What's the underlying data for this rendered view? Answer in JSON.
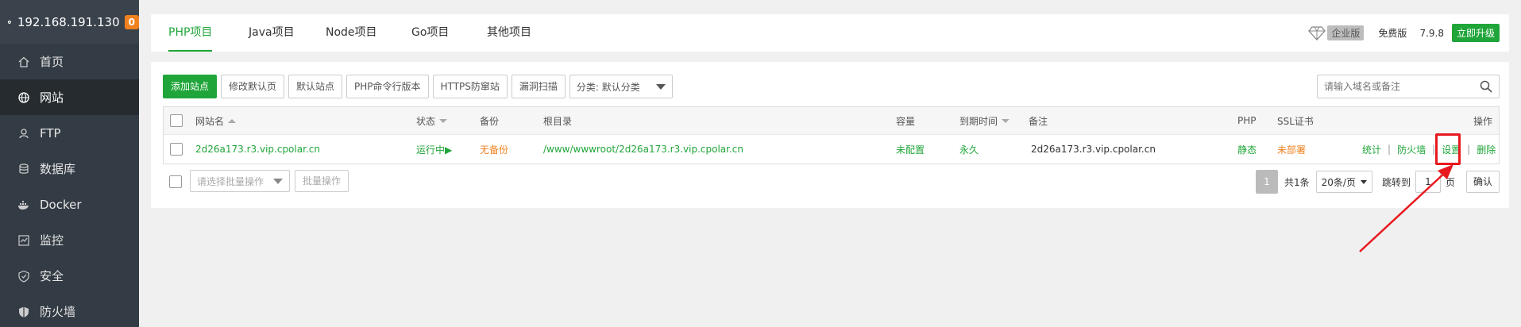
{
  "sidebar": {
    "ip": "192.168.191.130",
    "badge": "0",
    "items": [
      {
        "label": "首页",
        "icon": "home-icon"
      },
      {
        "label": "网站",
        "icon": "globe-icon"
      },
      {
        "label": "FTP",
        "icon": "ftp-icon"
      },
      {
        "label": "数据库",
        "icon": "database-icon"
      },
      {
        "label": "Docker",
        "icon": "docker-icon"
      },
      {
        "label": "监控",
        "icon": "monitor-icon"
      },
      {
        "label": "安全",
        "icon": "shield-check-icon"
      },
      {
        "label": "防火墙",
        "icon": "firewall-icon"
      }
    ]
  },
  "tabs": [
    "PHP项目",
    "Java项目",
    "Node项目",
    "Go项目",
    "其他项目"
  ],
  "topinfo": {
    "enterprise": "企业版",
    "free": "免费版",
    "version": "7.9.8",
    "upgrade": "立即升级"
  },
  "toolbar": {
    "add_site": "添加站点",
    "edit_default_page": "修改默认页",
    "default_site": "默认站点",
    "php_cli": "PHP命令行版本",
    "https_block": "HTTPS防窜站",
    "vuln_scan": "漏洞扫描",
    "category": "分类: 默认分类"
  },
  "search": {
    "placeholder": "请输入域名或备注"
  },
  "table": {
    "headers": {
      "name": "网站名",
      "status": "状态",
      "backup": "备份",
      "root": "根目录",
      "capacity": "容量",
      "expire": "到期时间",
      "remark": "备注",
      "php": "PHP",
      "ssl": "SSL证书",
      "action": "操作"
    },
    "row": {
      "name": "2d26a173.r3.vip.cpolar.cn",
      "status": "运行中▶",
      "backup": "无备份",
      "root": "/www/wwwroot/2d26a173.r3.vip.cpolar.cn",
      "capacity": "未配置",
      "expire": "永久",
      "remark": "2d26a173.r3.vip.cpolar.cn",
      "php": "静态",
      "ssl": "未部署",
      "stats": "统计",
      "firewall": "防火墙",
      "settings": "设置",
      "delete": "删除"
    }
  },
  "footer": {
    "batch_placeholder": "请选择批量操作",
    "batch_button": "批量操作",
    "page": "1",
    "total": "共1条",
    "per_page": "20条/页",
    "jump_to": "跳转到",
    "jump_value": "1",
    "page_unit": "页",
    "confirm": "确认"
  },
  "colors": {
    "accent": "#20a53a",
    "sidebar": "#333c44",
    "warning": "#f0811e",
    "annotation": "#e8191e"
  }
}
